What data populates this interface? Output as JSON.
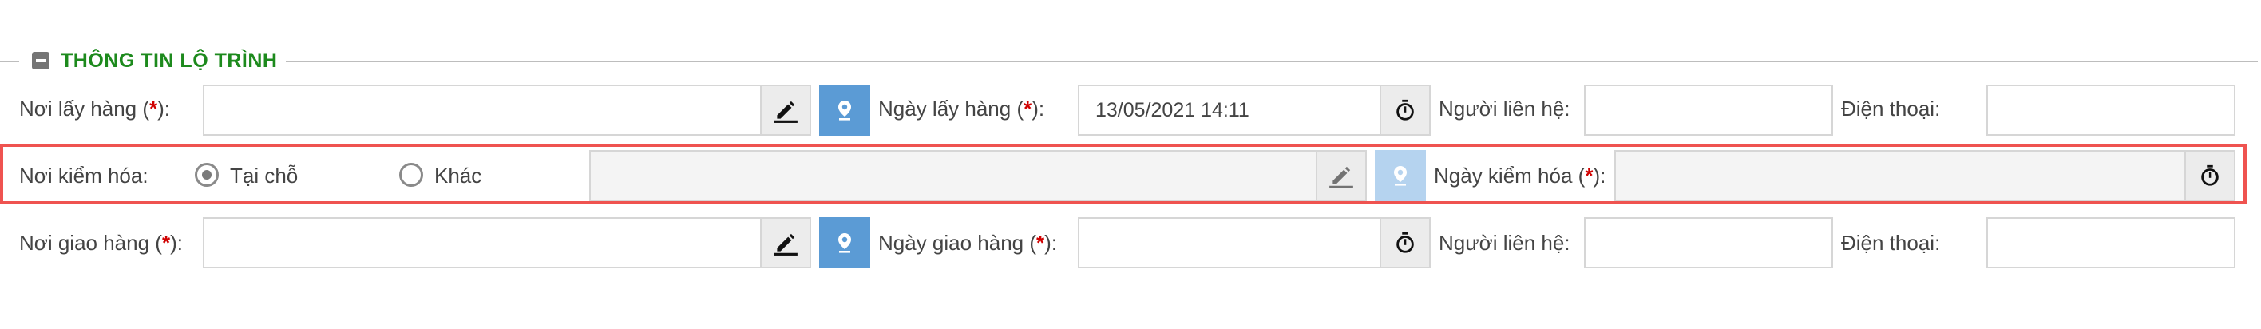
{
  "section": {
    "title": "THÔNG TIN LỘ TRÌNH"
  },
  "pickup": {
    "location_label": "Nơi lấy hàng (",
    "date_label": "Ngày lấy hàng (",
    "date_value": "13/05/2021 14:11",
    "contact_label": "Người liên hệ:",
    "phone_label": "Điện thoại:"
  },
  "inspection": {
    "location_label": "Nơi kiểm hóa:",
    "option_onsite": "Tại chỗ",
    "option_other": "Khác",
    "selected_option": "Tại chỗ",
    "date_label": "Ngày kiểm hóa ("
  },
  "delivery": {
    "location_label": "Nơi giao hàng (",
    "date_label": "Ngày giao hàng (",
    "contact_label": "Người liên hệ:",
    "phone_label": "Điện thoại:"
  },
  "common": {
    "required_mark": "*",
    "label_suffix": "):"
  },
  "icons": {
    "edit": "pencil-icon",
    "location": "map-pin-icon",
    "time": "stopwatch-icon",
    "collapse": "minus-square-icon"
  },
  "colors": {
    "section_title": "#1d8a1d",
    "required": "#d00000",
    "location_button": "#5b9bd5",
    "highlight_border": "#ef5350"
  }
}
